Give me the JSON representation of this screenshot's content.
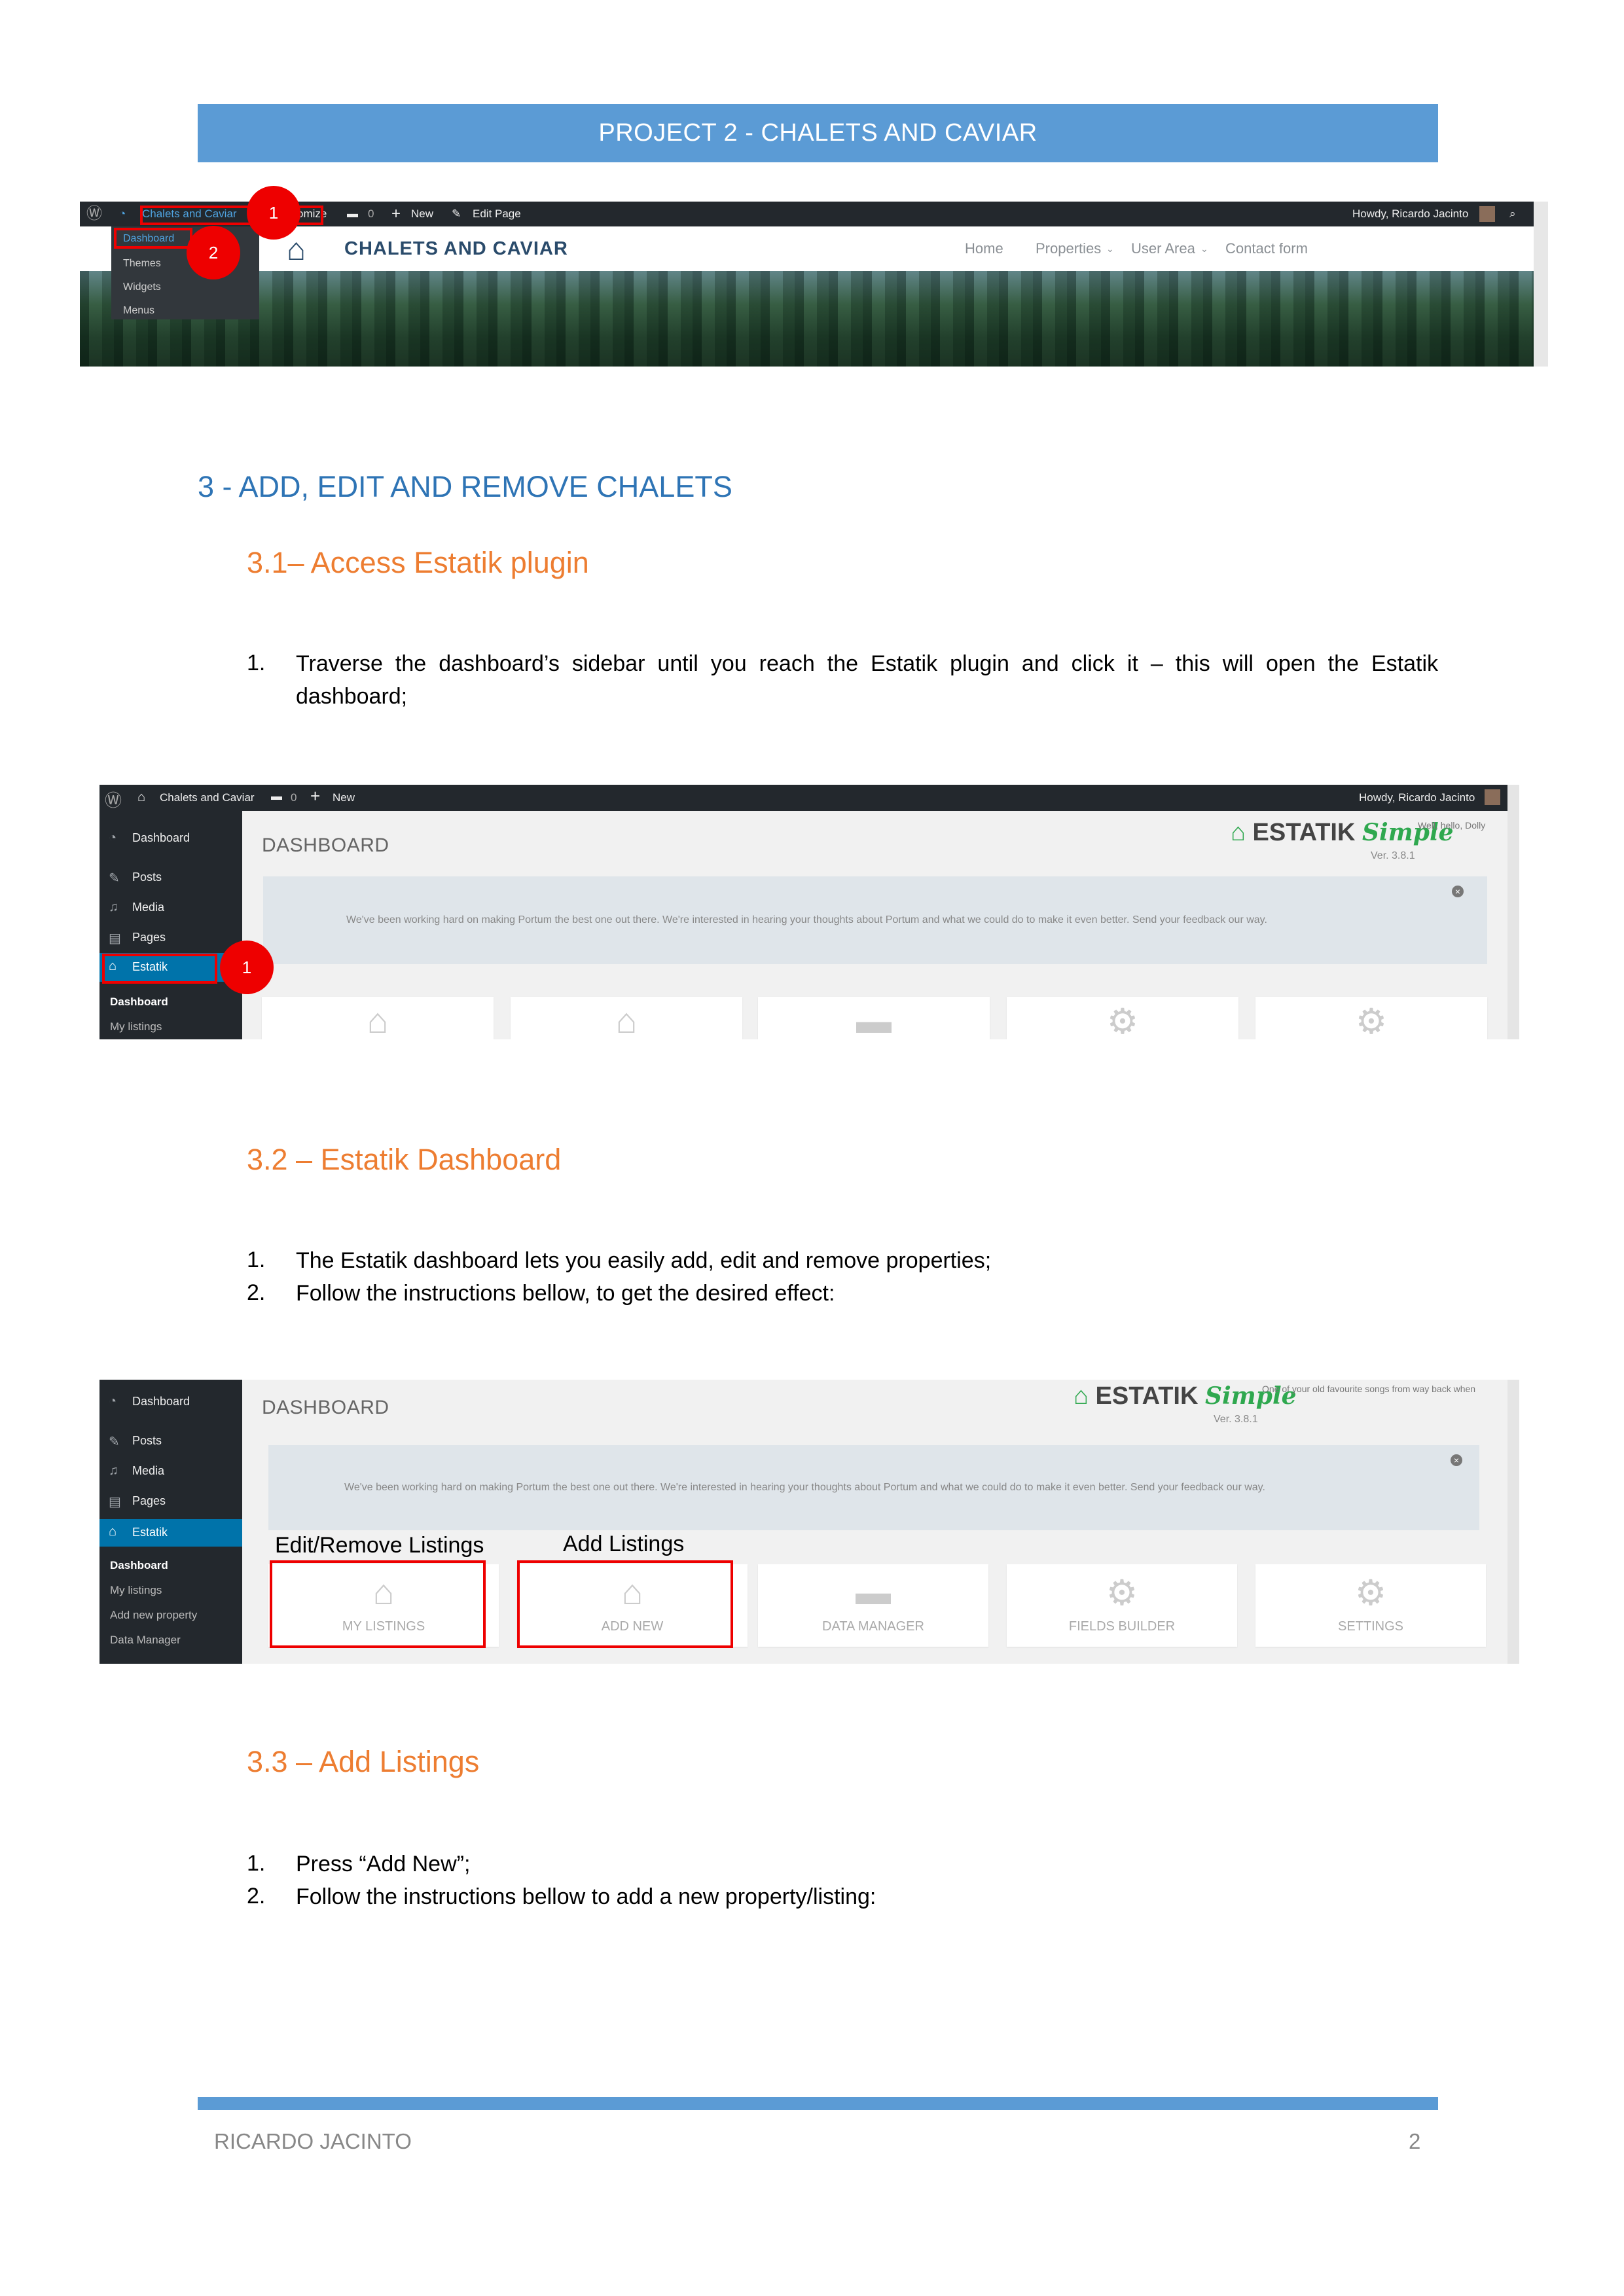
{
  "header": {
    "title": "PROJECT 2 - CHALETS AND CAVIAR"
  },
  "shot1": {
    "adminbar": {
      "site": "Chalets and Caviar",
      "customize": "omize",
      "comments": "0",
      "new": "New",
      "edit_page": "Edit Page",
      "howdy": "Howdy, Ricardo Jacinto"
    },
    "dropdown": [
      "Dashboard",
      "Themes",
      "Widgets",
      "Menus"
    ],
    "logo_text": "CHALETS AND CAVIAR",
    "nav": [
      "Home",
      "Properties",
      "User Area",
      "Contact form"
    ],
    "markers": [
      "1",
      "2"
    ]
  },
  "section3": {
    "title": "3 - ADD, EDIT AND REMOVE CHALETS",
    "s31": {
      "title": "3.1– Access Estatik plugin",
      "items": [
        {
          "num": "1.",
          "text": "Traverse the dashboard’s sidebar until you reach the Estatik plugin and click it – this will open the Estatik dashboard;"
        }
      ]
    },
    "s32": {
      "title": "3.2 – Estatik Dashboard",
      "items": [
        {
          "num": "1.",
          "text": "The Estatik dashboard lets you easily add, edit and remove properties;"
        },
        {
          "num": "2.",
          "text": "Follow the instructions bellow, to get the desired effect:"
        }
      ]
    },
    "s33": {
      "title": "3.3 – Add Listings",
      "items": [
        {
          "num": "1.",
          "text": "Press “Add New”;"
        },
        {
          "num": "2.",
          "text": "Follow the instructions bellow to add a new property/listing:"
        }
      ]
    }
  },
  "shot2": {
    "adminbar": {
      "site": "Chalets and Caviar",
      "comments": "0",
      "new": "New",
      "howdy": "Howdy, Ricardo Jacinto"
    },
    "sidebar": [
      "Dashboard",
      "Posts",
      "Media",
      "Pages",
      "Estatik"
    ],
    "submenu": [
      "Dashboard",
      "My listings"
    ],
    "dash_title": "DASHBOARD",
    "brand": {
      "name": "ESTATIK",
      "edition": "Simple",
      "version": "Ver. 3.8.1",
      "tagline": "Well, hello, Dolly"
    },
    "notice": "We've been working hard on making Portum the best one out there. We're interested in hearing your thoughts about Portum and what we could do to make it even better. Send your feedback our way.",
    "marker": "1"
  },
  "shot3": {
    "sidebar": [
      "Dashboard",
      "Posts",
      "Media",
      "Pages",
      "Estatik"
    ],
    "submenu": [
      "Dashboard",
      "My listings",
      "Add new property",
      "Data Manager"
    ],
    "dash_title": "DASHBOARD",
    "brand": {
      "name": "ESTATIK",
      "edition": "Simple",
      "version": "Ver. 3.8.1",
      "tagline": "One of your old favourite songs from way back when"
    },
    "notice": "We've been working hard on making Portum the best one out there. We're interested in hearing your thoughts about Portum and what we could do to make it even better. Send your feedback our way.",
    "cards": [
      "MY LISTINGS",
      "ADD NEW",
      "DATA MANAGER",
      "FIELDS BUILDER",
      "SETTINGS"
    ],
    "annotations": {
      "edit_remove": "Edit/Remove Listings",
      "add": "Add Listings"
    }
  },
  "footer": {
    "author": "RICARDO JACINTO",
    "page": "2"
  }
}
